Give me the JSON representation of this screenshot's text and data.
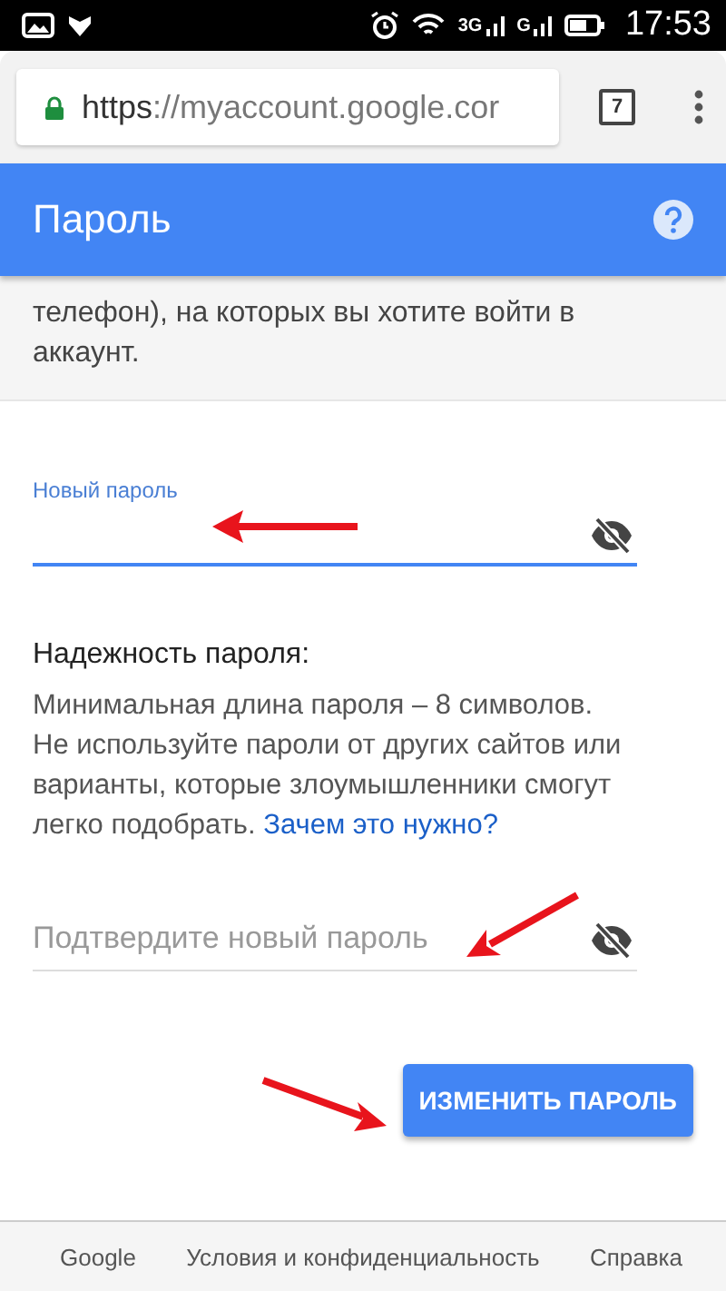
{
  "status_bar": {
    "network_labels": [
      "3G",
      "G"
    ],
    "time": "17:53"
  },
  "browser": {
    "url_scheme": "https",
    "url_rest": "://myaccount.google.cor",
    "tab_count": "7"
  },
  "header": {
    "title": "Пароль"
  },
  "intro": "телефон), на которых вы хотите войти в аккаунт.",
  "fields": [
    {
      "kind": "label",
      "label": "Новый пароль",
      "focused": true
    },
    {
      "kind": "placeholder",
      "placeholder": "Подтвердите новый пароль",
      "focused": false
    }
  ],
  "strength": {
    "title": "Надежность пароля:",
    "text": "Минимальная длина пароля – 8 символов. Не используйте пароли от других сайтов или варианты, которые злоумышленники смогут легко подобрать.",
    "link": "Зачем это нужно?"
  },
  "submit": "ИЗМЕНИТЬ ПАРОЛЬ",
  "footer": [
    "Google",
    "Условия и конфиденциальность",
    "Справка"
  ]
}
